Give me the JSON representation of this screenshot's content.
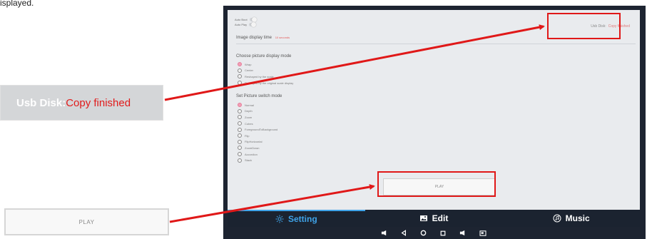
{
  "caption": "isplayed.",
  "settings": {
    "auto_boot_label": "Auto Boot",
    "auto_play_label": "Auto Play",
    "image_display_time_label": "Image display time",
    "image_display_time_value": "10 seconds",
    "display_mode_title": "Choose picture display mode",
    "display_modes": [
      {
        "label": "Wrap",
        "selected": true
      },
      {
        "label": "Center",
        "selected": false
      },
      {
        "label": "Reshaped by the scale",
        "selected": false
      },
      {
        "label": "Reshaped by the original scale display",
        "selected": false
      }
    ],
    "switch_mode_title": "Set Picture switch mode",
    "switch_modes": [
      {
        "label": "Normal",
        "selected": true
      },
      {
        "label": "Depth",
        "selected": false
      },
      {
        "label": "Zoom",
        "selected": false
      },
      {
        "label": "Cubes",
        "selected": false
      },
      {
        "label": "ForegroundToBackground",
        "selected": false
      },
      {
        "label": "Flip",
        "selected": false
      },
      {
        "label": "FlipHorizontal",
        "selected": false
      },
      {
        "label": "ZoomDown",
        "selected": false
      },
      {
        "label": "Accordion",
        "selected": false
      },
      {
        "label": "Stack",
        "selected": false
      }
    ],
    "usb_label": "Usb Disk:",
    "usb_status": "Copy finished",
    "play_label": "PLAY"
  },
  "tabs": [
    {
      "label": "Setting",
      "icon": "gear-icon",
      "active": true
    },
    {
      "label": "Edit",
      "icon": "image-icon",
      "active": false
    },
    {
      "label": "Music",
      "icon": "music-icon",
      "active": false
    }
  ],
  "nav_icons": [
    "volume-down-icon",
    "back-icon",
    "home-icon",
    "recent-apps-icon",
    "volume-up-icon",
    "screenshot-icon"
  ],
  "zoom": {
    "usb_label": "Usb Disk:",
    "usb_status": "Copy finished",
    "play_label": "PLAY"
  },
  "colors": {
    "highlight": "#e01818",
    "active_tab": "#3fa3e8",
    "selected_radio": "#f2a0b5",
    "status_text": "#e11b1b"
  }
}
